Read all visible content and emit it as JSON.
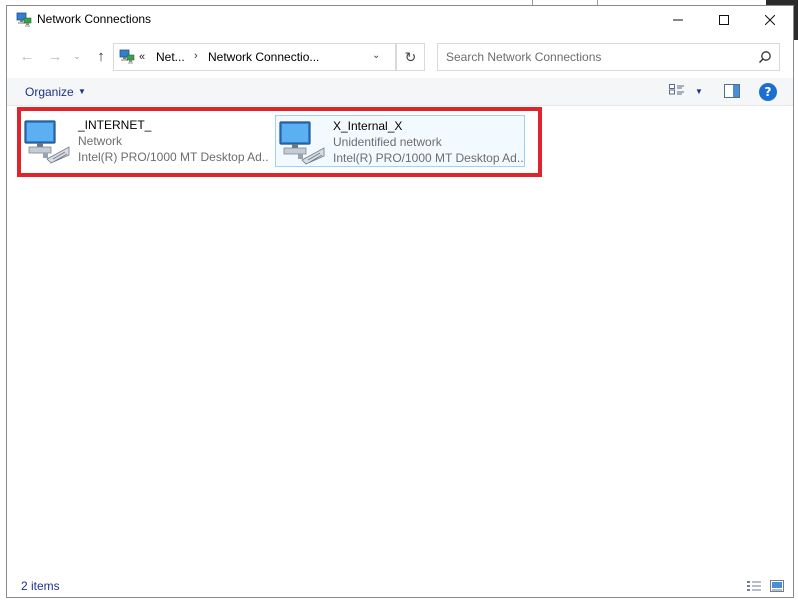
{
  "window": {
    "title": "Network Connections",
    "title_icon": "network-connections-icon"
  },
  "controls": {
    "minimize": "—",
    "maximize": "☐",
    "close": "✕"
  },
  "nav": {
    "back": "←",
    "forward": "→",
    "recent": "⌄",
    "up": "↑"
  },
  "address": {
    "overflow": "«",
    "crumbs": [
      "Net...",
      "Network Connectio..."
    ],
    "separator": "›",
    "dropdown": "⌄",
    "refresh": "↻"
  },
  "search": {
    "placeholder": "Search Network Connections",
    "icon": "search-icon"
  },
  "toolbar": {
    "organize_label": "Organize",
    "caret": "▼",
    "help": "?"
  },
  "connections": [
    {
      "name": "_INTERNET_",
      "status": "Network",
      "adapter": "Intel(R) PRO/1000 MT Desktop Ad...",
      "selected": false
    },
    {
      "name": "X_Internal_X",
      "status": "Unidentified network",
      "adapter": "Intel(R) PRO/1000 MT Desktop Ad...",
      "selected": true
    }
  ],
  "statusbar": {
    "count": "2 items"
  },
  "colors": {
    "highlight": "#e0242c",
    "accent": "#1e3287",
    "selection_border": "#99d1ff",
    "selection_fill": "#f2f9ff"
  }
}
